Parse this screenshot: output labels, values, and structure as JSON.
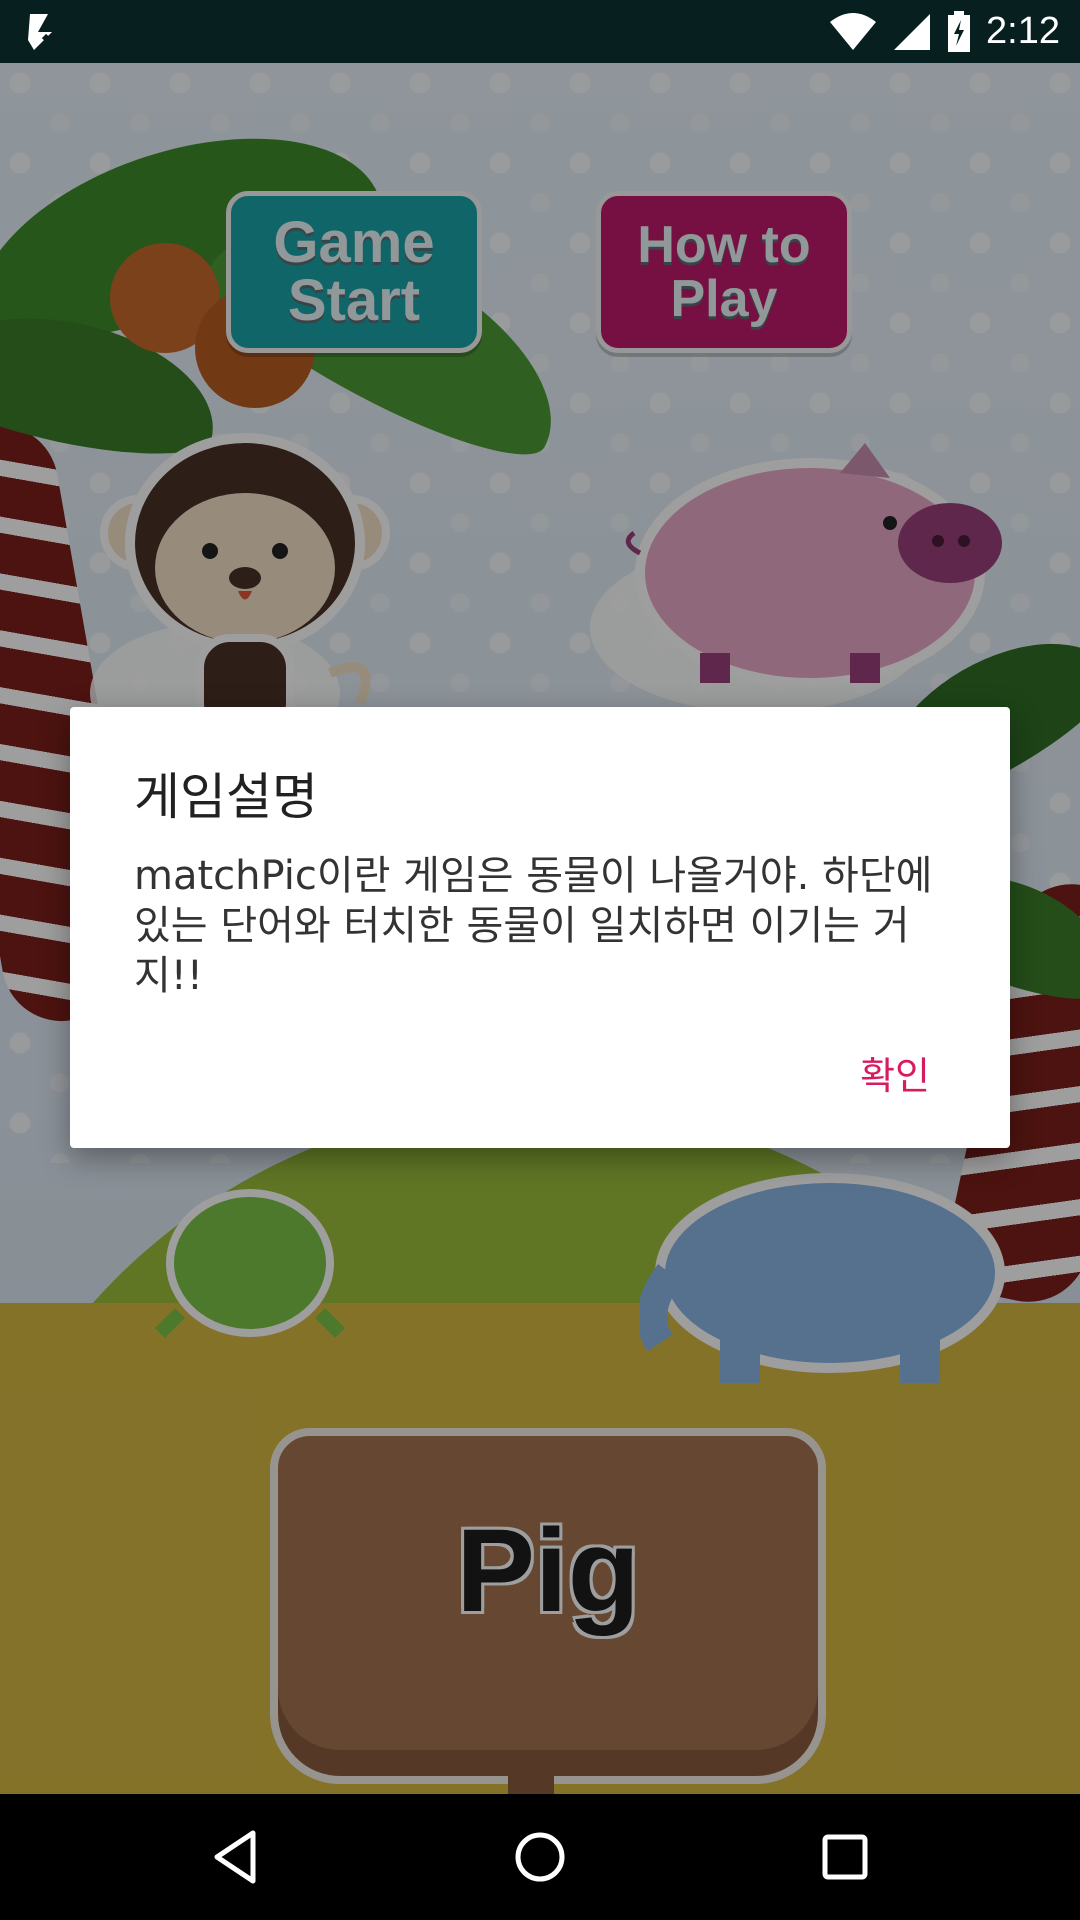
{
  "status_bar": {
    "time": "2:12",
    "icons": [
      "notification-check-icon",
      "wifi-icon",
      "cell-signal-icon",
      "battery-charging-icon"
    ]
  },
  "game": {
    "buttons": {
      "start_line1": "Game",
      "start_line2": "Start",
      "howto_line1": "How to",
      "howto_line2": "Play"
    },
    "sign_word": "Pig",
    "animals": [
      "monkey",
      "pig",
      "frog",
      "elephant"
    ]
  },
  "dialog": {
    "title": "게임설명",
    "message": "matchPic이란 게임은 동물이 나올거야. 하단에 있는 단어와 터치한  동물이 일치하면 이기는 거지!!",
    "ok_label": "확인"
  },
  "navigation": {
    "icons": [
      "back-icon",
      "home-icon",
      "recents-icon"
    ]
  },
  "colors": {
    "accent": "#d81b60",
    "start_button": "#1aa3aa",
    "howto_button": "#c01a6b",
    "status_bar": "#07201f"
  }
}
